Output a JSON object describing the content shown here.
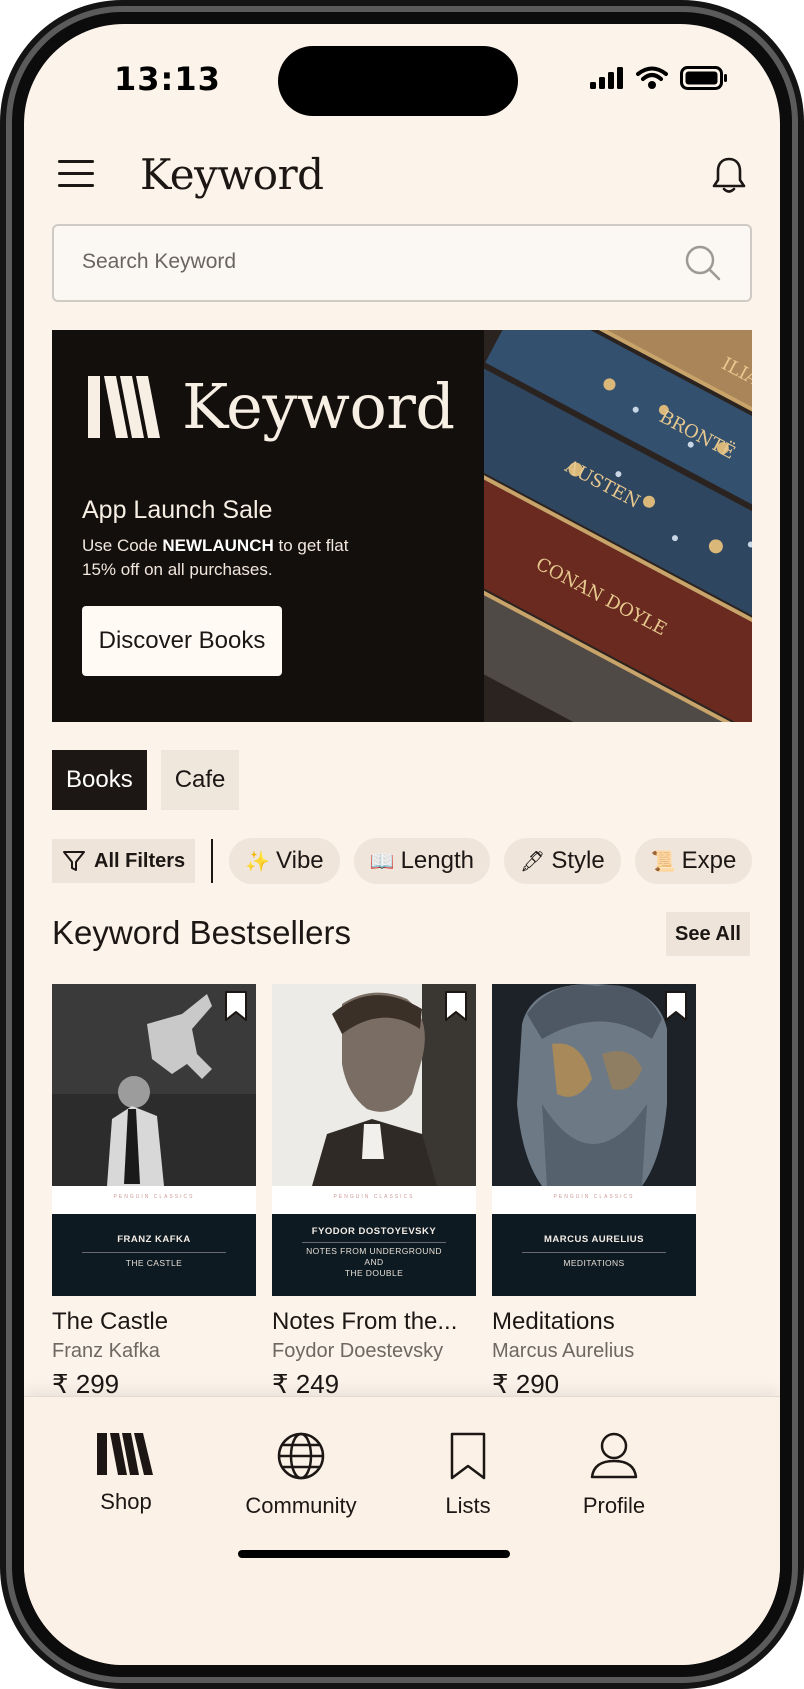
{
  "status_bar": {
    "time": "13:13"
  },
  "header": {
    "brand": "Keyword"
  },
  "search": {
    "placeholder": "Search Keyword"
  },
  "banner": {
    "brand": "Keyword",
    "title": "App Launch Sale",
    "text_prefix": "Use Code ",
    "code": "NEWLAUNCH",
    "text_suffix": " to get flat 15% off on all purchases.",
    "button": "Discover Books"
  },
  "tabs": [
    "Books",
    "Cafe"
  ],
  "filters": {
    "all_filters": "All Filters",
    "chips": [
      {
        "emoji": "✨",
        "label": "Vibe"
      },
      {
        "emoji": "📖",
        "label": "Length"
      },
      {
        "emoji": "🖋",
        "label": "Style"
      },
      {
        "emoji": "📜",
        "label": "Expe"
      }
    ]
  },
  "section": {
    "title": "Keyword Bestsellers",
    "see_all": "See All"
  },
  "books": [
    {
      "title": "The Castle",
      "author": "Franz Kafka",
      "price": "₹ 299",
      "cover_band": "PENGUIN CLASSICS",
      "cover_author": "FRANZ KAFKA",
      "cover_subtitle": "THE CASTLE"
    },
    {
      "title": "Notes From the...",
      "author": "Foydor Doestevsky",
      "price": "₹ 249",
      "cover_band": "PENGUIN CLASSICS",
      "cover_author": "FYODOR DOSTOYEVSKY",
      "cover_subtitle": "NOTES FROM UNDERGROUND\nAND\nTHE DOUBLE"
    },
    {
      "title": "Meditations",
      "author": "Marcus Aurelius",
      "price": "₹ 290",
      "cover_band": "PENGUIN CLASSICS",
      "cover_author": "MARCUS AURELIUS",
      "cover_subtitle": "MEDITATIONS"
    }
  ],
  "nav": {
    "shop": "Shop",
    "community": "Community",
    "lists": "Lists",
    "profile": "Profile"
  },
  "colors": {
    "background": "#fcf3ea",
    "dark": "#1c1714",
    "chip": "#efe5db",
    "banner": "#120f0d"
  },
  "icons": [
    "menu-icon",
    "bell-icon",
    "search-icon",
    "filter-icon",
    "bookmark-icon",
    "shop-icon",
    "globe-icon",
    "list-bookmark-icon",
    "profile-icon"
  ]
}
